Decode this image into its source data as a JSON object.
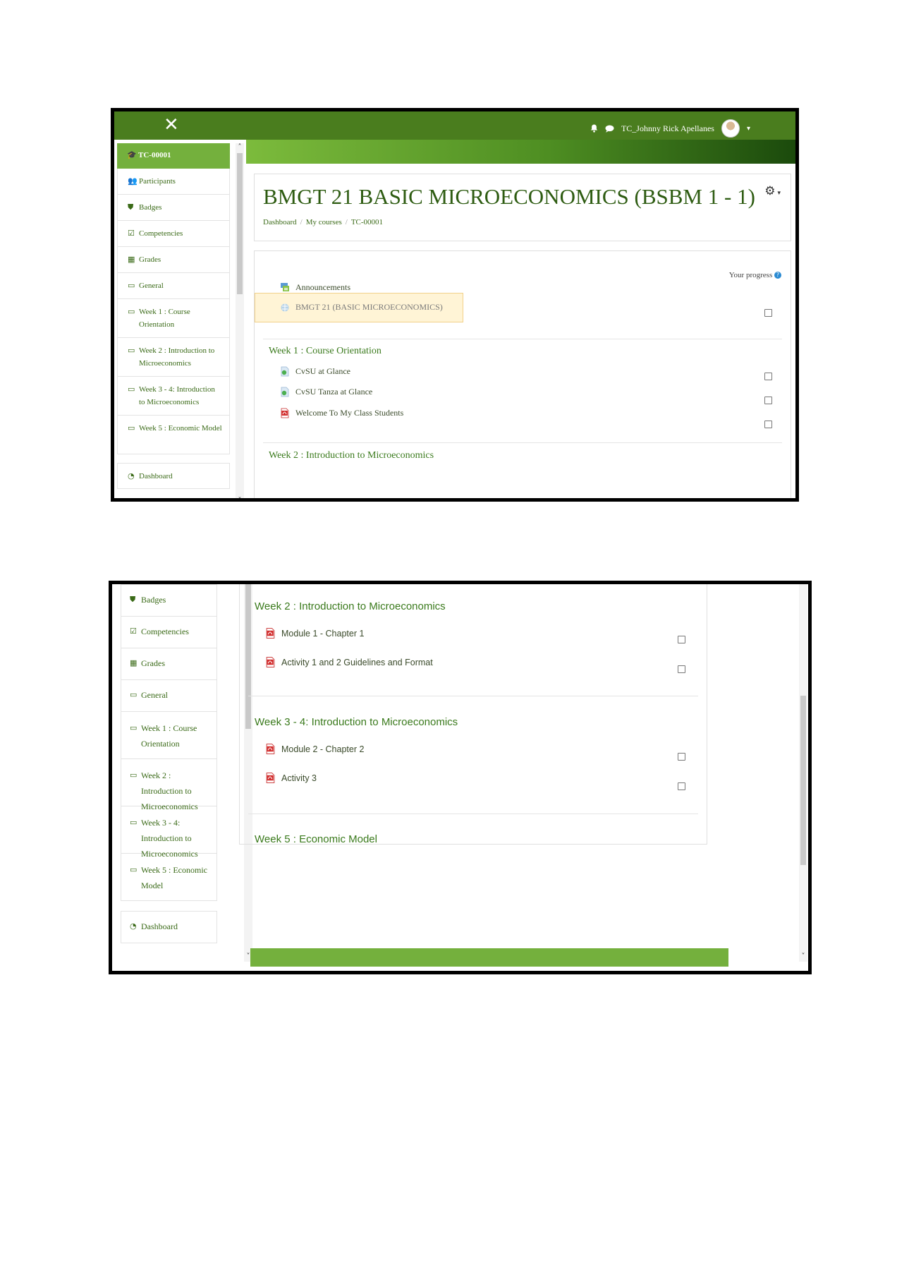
{
  "shot1": {
    "topbar": {
      "close_icon": "close-icon",
      "user_name": "TC_Johnny Rick Apellanes",
      "bell_icon": "bell-icon",
      "chat_icon": "chat-icon"
    },
    "sidebar": {
      "head": "TC-00001",
      "items": [
        {
          "icon": "👥",
          "label": "Participants"
        },
        {
          "icon": "⛊",
          "label": "Badges"
        },
        {
          "icon": "☑",
          "label": "Competencies"
        },
        {
          "icon": "▦",
          "label": "Grades"
        },
        {
          "icon": "▭",
          "label": "General"
        },
        {
          "icon": "▭",
          "label": "Week 1 : Course Orientation"
        },
        {
          "icon": "▭",
          "label": "Week 2 : Introduction to Microeconomics"
        },
        {
          "icon": "▭",
          "label": "Week 3 - 4: Introduction to Microeconomics"
        },
        {
          "icon": "▭",
          "label": "Week 5 : Economic Model"
        }
      ],
      "dashboard": "Dashboard"
    },
    "course_title": "BMGT 21 BASIC MICROECONOMICS (BSBM 1 - 1)",
    "breadcrumb": [
      "Dashboard",
      "My courses",
      "TC-00001"
    ],
    "your_progress": "Your progress",
    "general_activities": [
      "Announcements",
      "BMGT 21 (BASIC MICROECONOMICS)"
    ],
    "week1": {
      "title": "Week 1 : Course Orientation",
      "activities": [
        "CvSU at Glance",
        "CvSU Tanza at Glance",
        "Welcome To My Class Students"
      ]
    },
    "week2_title": "Week 2 : Introduction to Microeconomics"
  },
  "shot2": {
    "sidebar": {
      "items": [
        {
          "icon": "⛊",
          "label": "Badges"
        },
        {
          "icon": "☑",
          "label": "Competencies"
        },
        {
          "icon": "▦",
          "label": "Grades"
        },
        {
          "icon": "▭",
          "label": "General"
        },
        {
          "icon": "▭",
          "label": "Week 1 : Course Orientation"
        },
        {
          "icon": "▭",
          "label": "Week 2 : Introduction to Microeconomics"
        },
        {
          "icon": "▭",
          "label": "Week 3 - 4: Introduction to Microeconomics"
        },
        {
          "icon": "▭",
          "label": "Week 5 : Economic Model"
        }
      ],
      "dashboard": "Dashboard"
    },
    "week2": {
      "title": "Week 2 : Introduction to Microeconomics",
      "activities": [
        "Module 1 - Chapter 1",
        "Activity 1 and 2 Guidelines and Format"
      ]
    },
    "week34": {
      "title": "Week 3 - 4: Introduction to Microeconomics",
      "activities": [
        "Module 2 - Chapter 2",
        "Activity 3"
      ]
    },
    "week5": {
      "title": "Week 5 : Economic Model"
    }
  },
  "colors": {
    "nav": "#4a7d1e",
    "accent": "#74b03d",
    "highlight": "#fff4d6"
  }
}
